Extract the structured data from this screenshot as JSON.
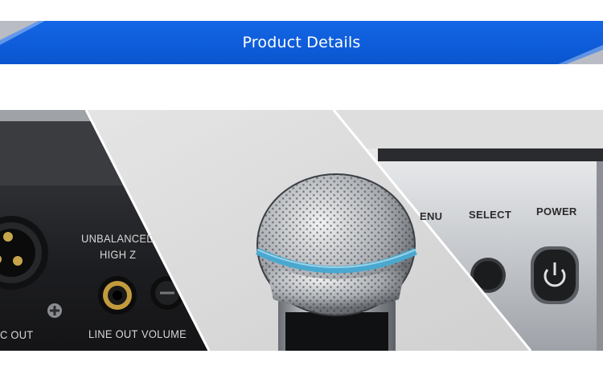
{
  "banner": {
    "title": "Product Details",
    "color": "#0a5bd6"
  },
  "receiver_panel": {
    "labels": {
      "unbalanced": "UNBALANCED",
      "high_z": "HIGH Z",
      "mic_out": "C OUT",
      "line_out": "LINE OUT",
      "volume": "VOLUME"
    }
  },
  "front_panel": {
    "labels": {
      "menu": "ENU",
      "select": "SELECT",
      "power": "POWER"
    },
    "icons": [
      "power-icon"
    ]
  }
}
